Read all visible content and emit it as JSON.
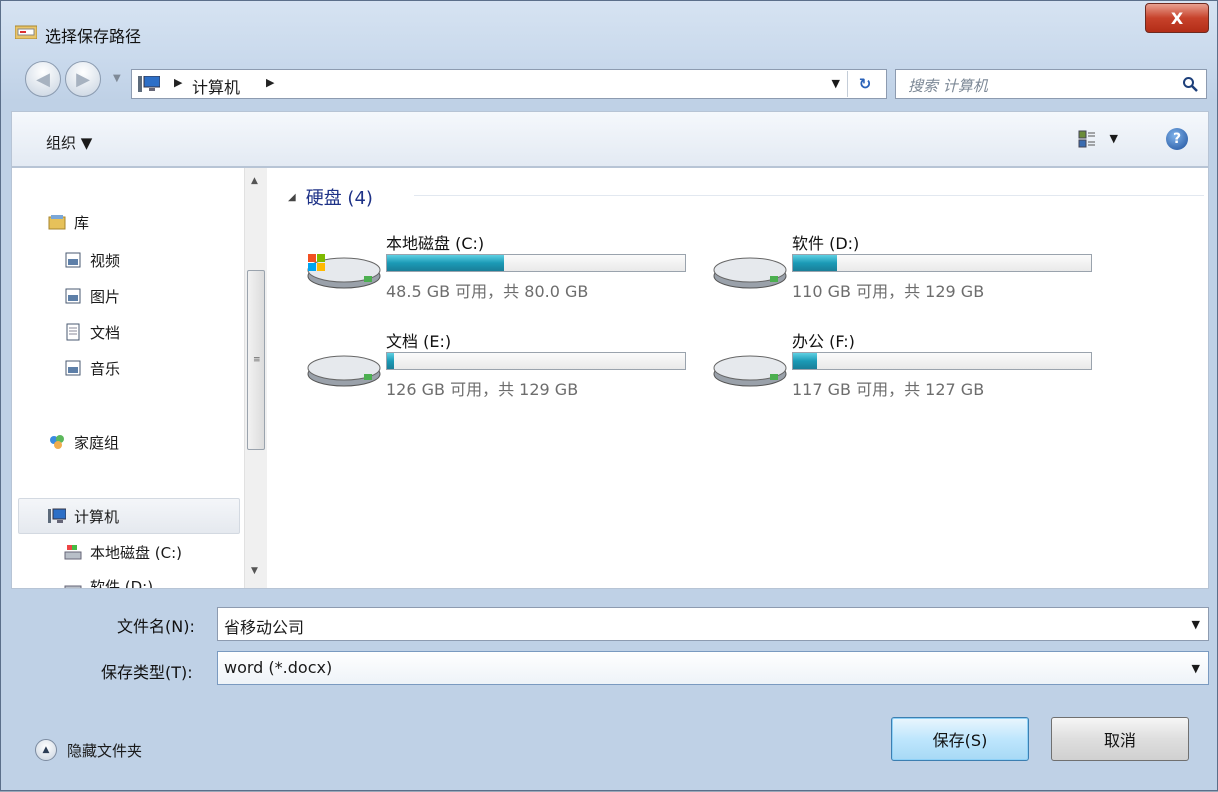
{
  "window": {
    "title": "选择保存路径",
    "close_label": "X"
  },
  "address": {
    "location": "计算机",
    "search_placeholder": "搜索 计算机"
  },
  "toolbar": {
    "organize_label": "组织 ▼"
  },
  "nav": {
    "items": [
      {
        "label": "库",
        "icon": "library-icon"
      },
      {
        "label": "视频",
        "icon": "video-library-icon"
      },
      {
        "label": "图片",
        "icon": "pictures-library-icon"
      },
      {
        "label": "文档",
        "icon": "documents-library-icon"
      },
      {
        "label": "音乐",
        "icon": "music-library-icon"
      },
      {
        "label": "家庭组",
        "icon": "homegroup-icon"
      },
      {
        "label": "计算机",
        "icon": "computer-icon"
      },
      {
        "label": "本地磁盘 (C:)",
        "icon": "local-disk-icon"
      },
      {
        "label": "软件 (D:)",
        "icon": "drive-icon"
      }
    ]
  },
  "group": {
    "title": "硬盘 (4)"
  },
  "drives": [
    {
      "name": "本地磁盘 (C:)",
      "space": "48.5 GB 可用，共 80.0 GB",
      "used_fraction": 0.394,
      "system": true
    },
    {
      "name": "软件 (D:)",
      "space": "110 GB 可用，共 129 GB",
      "used_fraction": 0.147,
      "system": false
    },
    {
      "name": "文档 (E:)",
      "space": "126 GB 可用，共 129 GB",
      "used_fraction": 0.023,
      "system": false
    },
    {
      "name": "办公 (F:)",
      "space": "117 GB 可用，共 127 GB",
      "used_fraction": 0.079,
      "system": false
    }
  ],
  "form": {
    "filename_label": "文件名(N):",
    "filename_value": "省移动公司",
    "filetype_label": "保存类型(T):",
    "filetype_value": "word (*.docx)"
  },
  "footer": {
    "hide_folders_label": "隐藏文件夹",
    "save_label": "保存(S)",
    "cancel_label": "取消"
  }
}
